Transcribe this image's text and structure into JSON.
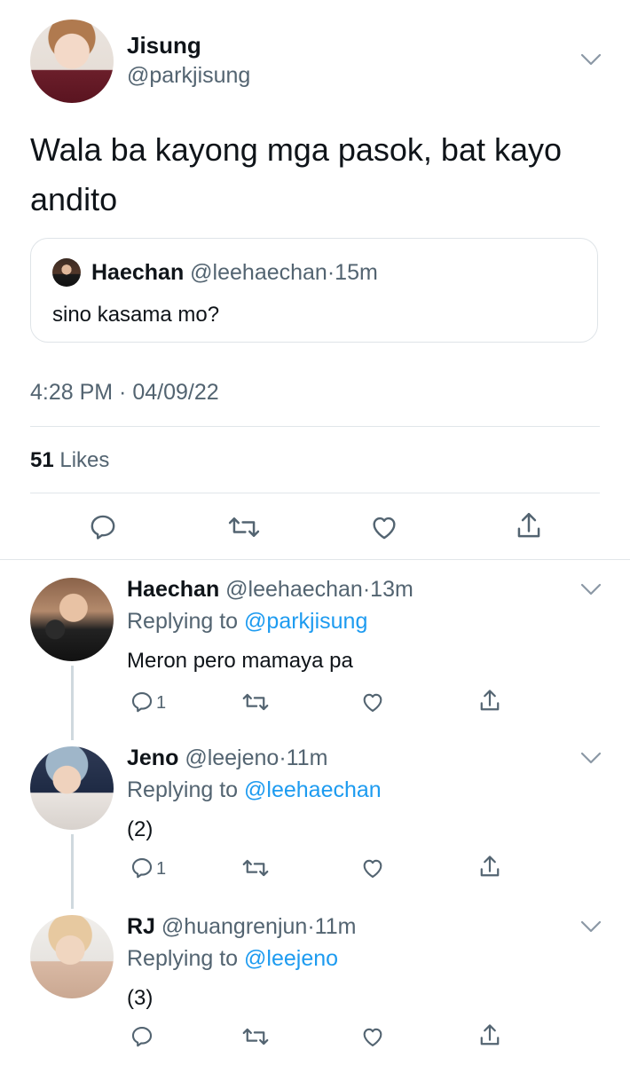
{
  "main_tweet": {
    "author_name": "Jisung",
    "author_handle": "@parkjisung",
    "text_line1": "Wala ba kayong mga pasok, bat kayo",
    "text_line2": "andito",
    "quote": {
      "author_name": "Haechan",
      "author_handle": "@leehaechan",
      "sep": "·",
      "time": "15m",
      "text": "sino kasama mo?"
    },
    "timestamp": "4:28 PM · 04/09/22",
    "likes_count": "51",
    "likes_label": "Likes"
  },
  "replies": [
    {
      "author_name": "Haechan",
      "author_handle": "@leehaechan",
      "sep": "·",
      "time": "13m",
      "replying_prefix": "Replying to",
      "replying_handle": "@parkjisung",
      "text": "Meron pero mamaya pa",
      "reply_count": "1"
    },
    {
      "author_name": "Jeno",
      "author_handle": "@leejeno",
      "sep": "·",
      "time": "11m",
      "replying_prefix": "Replying to",
      "replying_handle": "@leehaechan",
      "text": "(2)",
      "reply_count": "1"
    },
    {
      "author_name": "RJ",
      "author_handle": "@huangrenjun",
      "sep": "·",
      "time": "11m",
      "replying_prefix": "Replying to",
      "replying_handle": "@leejeno",
      "text": "(3)",
      "reply_count": ""
    }
  ],
  "icons": {
    "reply": "reply-icon",
    "retweet": "retweet-icon",
    "like": "heart-icon",
    "share": "share-icon",
    "more": "chevron-down-icon"
  },
  "colors": {
    "link": "#1d9bf0",
    "muted": "#536471",
    "text": "#0f1419"
  }
}
